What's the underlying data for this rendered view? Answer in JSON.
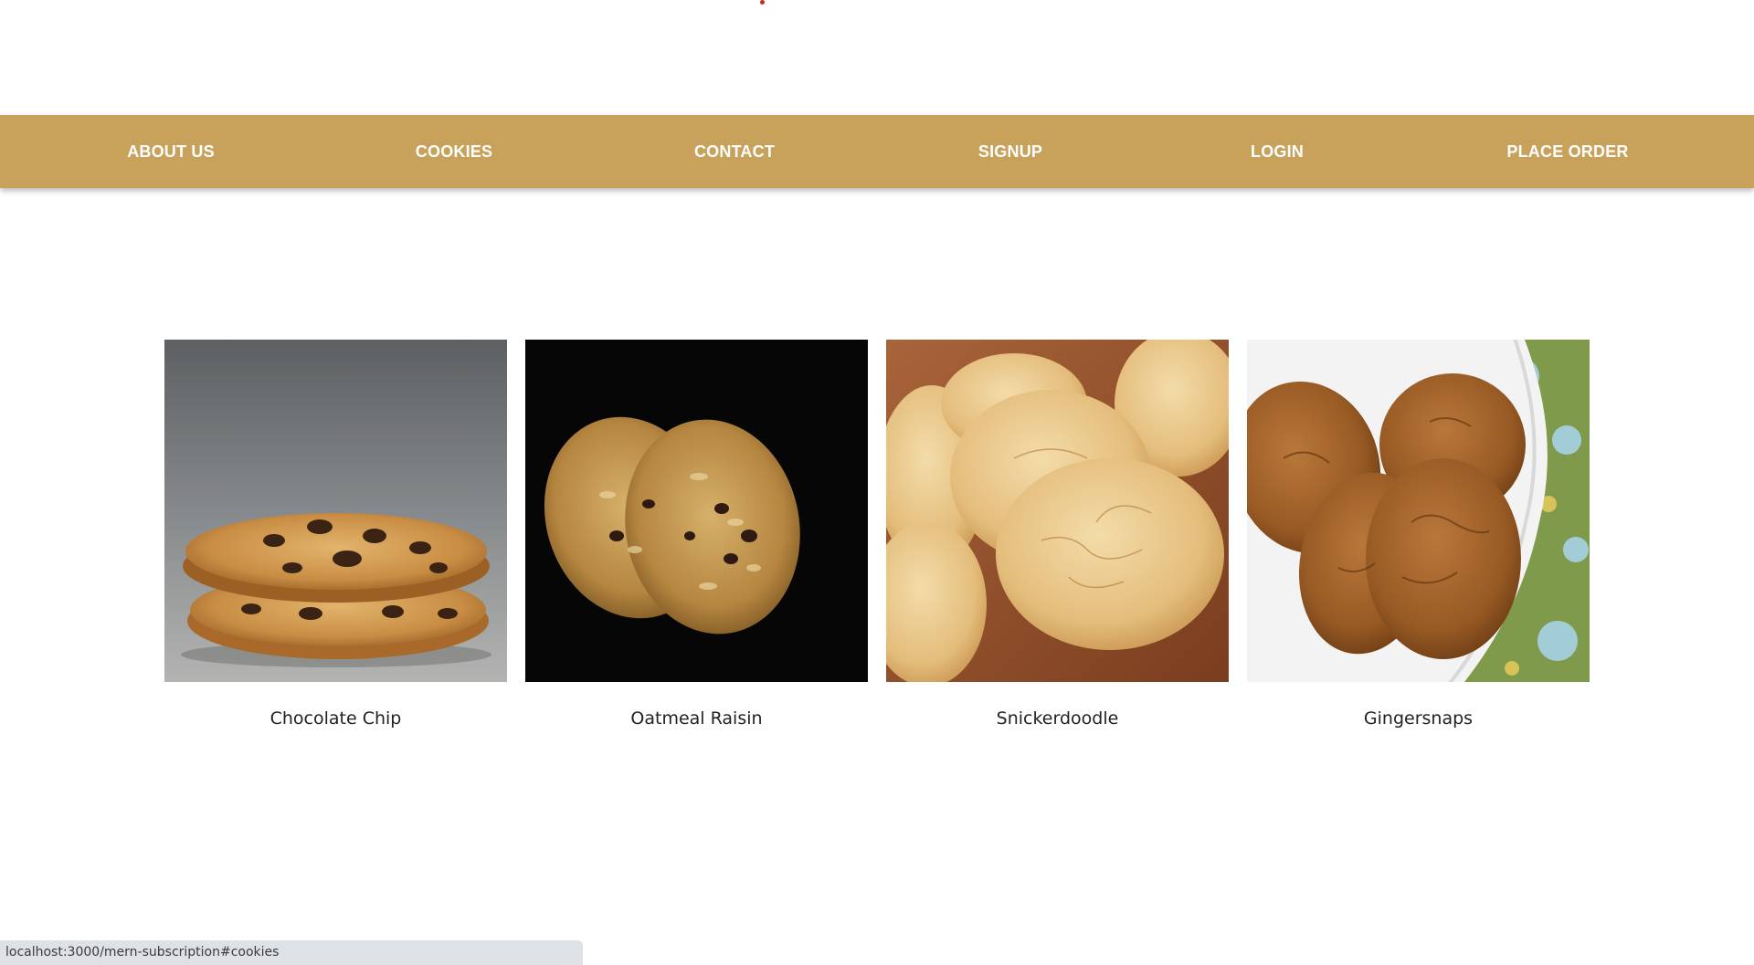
{
  "nav": {
    "items": [
      {
        "label": "ABOUT US"
      },
      {
        "label": "COOKIES"
      },
      {
        "label": "CONTACT"
      },
      {
        "label": "SIGNUP"
      },
      {
        "label": "LOGIN"
      },
      {
        "label": "PLACE ORDER"
      }
    ]
  },
  "cookies": [
    {
      "name": "Chocolate Chip",
      "image": "chocolate-chip-cookie-photo"
    },
    {
      "name": "Oatmeal Raisin",
      "image": "oatmeal-raisin-cookie-photo"
    },
    {
      "name": "Snickerdoodle",
      "image": "snickerdoodle-cookie-photo"
    },
    {
      "name": "Gingersnaps",
      "image": "gingersnap-cookie-photo"
    }
  ],
  "status_bar": {
    "url": "localhost:3000/mern-subscription#cookies"
  },
  "colors": {
    "navbar": "#c8a25a",
    "nav_text": "#ffffff",
    "status_bar": "#dee1e6"
  }
}
